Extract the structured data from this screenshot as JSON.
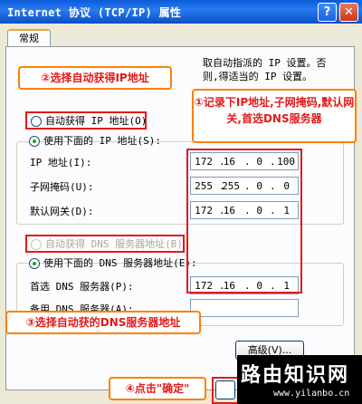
{
  "window": {
    "title": "Internet 协议 (TCP/IP) 属性",
    "help_label": "?",
    "close_label": "✕"
  },
  "tab": {
    "label": "常规"
  },
  "intro_text": "取自动指派的 IP 设置。否则,得适当的 IP 设置。",
  "ip_section": {
    "auto_option": "自动获得 IP 地址(O)",
    "manual_option": "使用下面的 IP 地址(S):",
    "auto_selected": false,
    "fields": [
      {
        "label": "IP 地址(I):",
        "octets": [
          "172",
          "16",
          "0",
          "100"
        ]
      },
      {
        "label": "子网掩码(U):",
        "octets": [
          "255",
          "255",
          "0",
          "0"
        ]
      },
      {
        "label": "默认网关(D):",
        "octets": [
          "172",
          "16",
          "0",
          "1"
        ]
      }
    ]
  },
  "dns_section": {
    "auto_option": "自动获得 DNS 服务器地址(B)",
    "manual_option": "使用下面的 DNS 服务器地址(E):",
    "fields": [
      {
        "label": "首选 DNS 服务器(P):",
        "octets": [
          "172",
          "16",
          "0",
          "1"
        ]
      },
      {
        "label": "备用 DNS 服务器(A):",
        "octets": [
          "",
          "",
          "",
          ""
        ]
      }
    ]
  },
  "advanced_button": "高级(V)...",
  "annotations": {
    "step1": "①记录下IP地址,子网掩码,默认网关,首选DNS服务器",
    "step2": "②选择自动获得IP地址",
    "step3": "③选择自动获的DNS服务器地址",
    "step4": "④点击\"确定\""
  },
  "watermark": {
    "main": "路由知识网",
    "url": "www.yilanbo.cn"
  },
  "colors": {
    "annotation_red": "#e21a1a",
    "annotation_orange": "#ff7f00",
    "titlebar_blue": "#0a5cd9"
  }
}
